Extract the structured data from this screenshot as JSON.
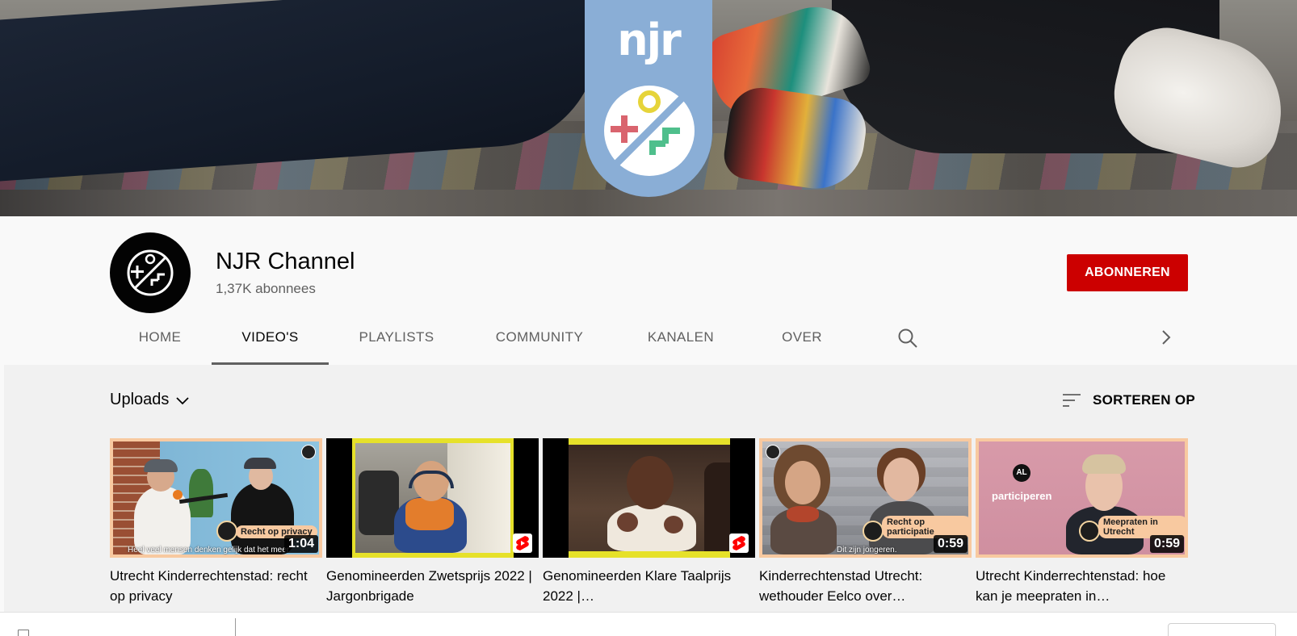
{
  "banner": {
    "logo_text": "njr"
  },
  "channel": {
    "name": "NJR Channel",
    "subscribers": "1,37K abonnees",
    "subscribe_label": "ABONNEREN"
  },
  "tabs": [
    {
      "label": "HOME",
      "active": false
    },
    {
      "label": "VIDEO'S",
      "active": true
    },
    {
      "label": "PLAYLISTS",
      "active": false
    },
    {
      "label": "COMMUNITY",
      "active": false
    },
    {
      "label": "KANALEN",
      "active": false
    },
    {
      "label": "OVER",
      "active": false
    }
  ],
  "toolbar": {
    "uploads_label": "Uploads",
    "sort_label": "SORTEREN OP"
  },
  "videos": [
    {
      "title": "Utrecht Kinderrechtenstad: recht op privacy",
      "duration": "1:04",
      "caption": "Recht op privacy",
      "subtitle": "Heel veel mensen denken gelijk dat het meer"
    },
    {
      "title": "Genomineerden Zwetsprijs 2022 | Jargonbrigade",
      "duration": "",
      "short": true
    },
    {
      "title": "Genomineerden Klare Taalprijs 2022 |…",
      "duration": "",
      "short": true
    },
    {
      "title": "Kinderrechtenstad Utrecht: wethouder Eelco over…",
      "duration": "0:59",
      "caption": "Recht op participatie",
      "subtitle": "Dit zijn jongeren."
    },
    {
      "title": "Utrecht Kinderrechtenstad: hoe kan je meepraten in…",
      "duration": "0:59",
      "caption": "Meepraten in Utrecht",
      "overlay_word": "participeren",
      "overlay_badge": "AL"
    }
  ],
  "colors": {
    "accent_red": "#cc0000",
    "logo_blue": "#8aaed6",
    "thumb_border": "#f8c9a0"
  }
}
